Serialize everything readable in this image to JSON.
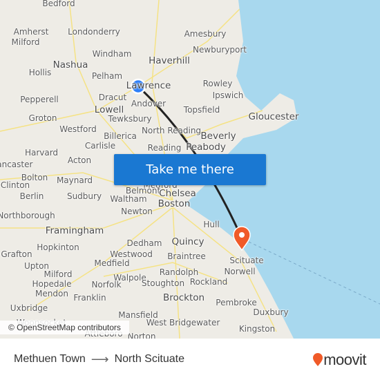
{
  "map": {
    "labels": [
      "Bedford",
      "Amherst",
      "Milford",
      "Londonderry",
      "Windham",
      "Nashua",
      "Hollis",
      "Pelham",
      "Lawrence",
      "Dracut",
      "Andover",
      "Lowell",
      "Pepperell",
      "Groton",
      "Tewksbury",
      "Westford",
      "Billerica",
      "Carlisle",
      "North Reading",
      "Reading",
      "Harvard",
      "Acton",
      "Amesbury",
      "Haverhill",
      "Newburyport",
      "Rowley",
      "Ipswich",
      "Topsfield",
      "Gloucester",
      "Beverly",
      "Peabody",
      "Lancaster",
      "Bolton",
      "Maynard",
      "Clinton",
      "Berlin",
      "Sudbury",
      "Medford",
      "Belmont",
      "Waltham",
      "Chelsea",
      "Boston",
      "Newton",
      "Northborough",
      "Hull",
      "Framingham",
      "Hopkinton",
      "Quincy",
      "Dedham",
      "Westwood",
      "Braintree",
      "Grafton",
      "Upton",
      "Medfield",
      "Milford",
      "Hopedale",
      "Walpole",
      "Norfolk",
      "Randolph",
      "Rockland",
      "Scituate",
      "Norwell",
      "Mendon",
      "Franklin",
      "Stoughton",
      "Uxbridge",
      "Brockton",
      "Pembroke",
      "Mansfield",
      "West Bridgewater",
      "Duxbury",
      "Kingston",
      "Woonsocket",
      "Attleboro",
      "Norton"
    ],
    "origin_color": "#2d7ff9",
    "destination_color": "#f05a28",
    "route_color": "#222222",
    "water_color": "#a8d8ee"
  },
  "cta": {
    "label": "Take me there"
  },
  "attribution": "© OpenStreetMap contributors",
  "footer": {
    "origin": "Methuen Town",
    "arrow_icon": "arrow-right-icon",
    "destination": "North Scituate",
    "brand": "moovit",
    "brand_color": "#f05a28"
  }
}
